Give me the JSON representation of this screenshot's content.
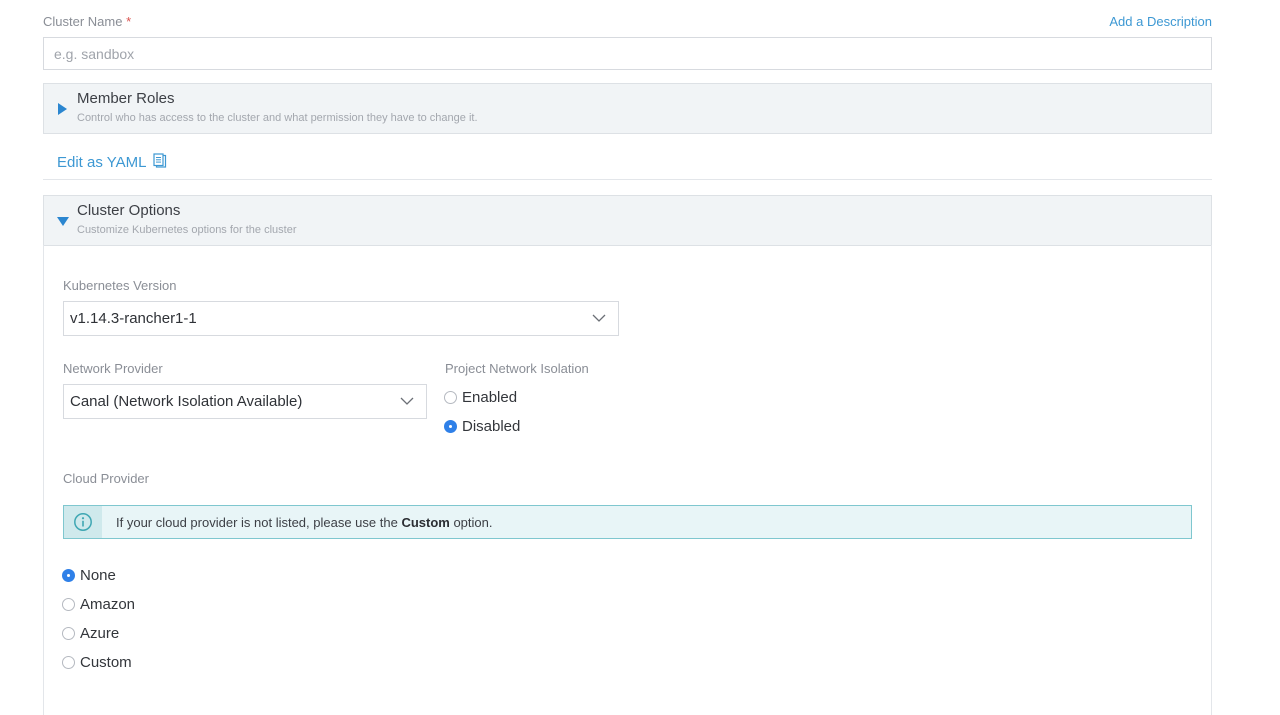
{
  "cluster_name": {
    "label": "Cluster Name",
    "required_mark": "*",
    "placeholder": "e.g. sandbox",
    "value": "",
    "add_description_link": "Add a Description"
  },
  "member_roles": {
    "title": "Member Roles",
    "subtitle": "Control who has access to the cluster and what permission they have to change it.",
    "expanded": false
  },
  "edit_yaml": {
    "label": "Edit as YAML"
  },
  "cluster_options": {
    "title": "Cluster Options",
    "subtitle": "Customize Kubernetes options for the cluster",
    "expanded": true,
    "kubernetes_version": {
      "label": "Kubernetes Version",
      "value": "v1.14.3-rancher1-1"
    },
    "network_provider": {
      "label": "Network Provider",
      "value": "Canal (Network Isolation Available)"
    },
    "project_network_isolation": {
      "label": "Project Network Isolation",
      "options": [
        {
          "label": "Enabled",
          "checked": false
        },
        {
          "label": "Disabled",
          "checked": true
        }
      ]
    },
    "cloud_provider": {
      "label": "Cloud Provider",
      "info_prefix": "If your cloud provider is not listed, please use the ",
      "info_bold": "Custom",
      "info_suffix": " option.",
      "options": [
        {
          "label": "None",
          "checked": true
        },
        {
          "label": "Amazon",
          "checked": false
        },
        {
          "label": "Azure",
          "checked": false
        },
        {
          "label": "Custom",
          "checked": false
        }
      ]
    }
  },
  "colors": {
    "accent": "#3d98d3",
    "radio_checked": "#2f80e8",
    "info_border": "#7fc7cf",
    "info_bg": "#e8f5f7"
  },
  "icons": {
    "collapsed": "caret-right-icon",
    "expanded": "caret-down-icon",
    "yaml": "clipboard-icon",
    "dropdown": "chevron-down-icon",
    "info": "info-circle-icon"
  }
}
